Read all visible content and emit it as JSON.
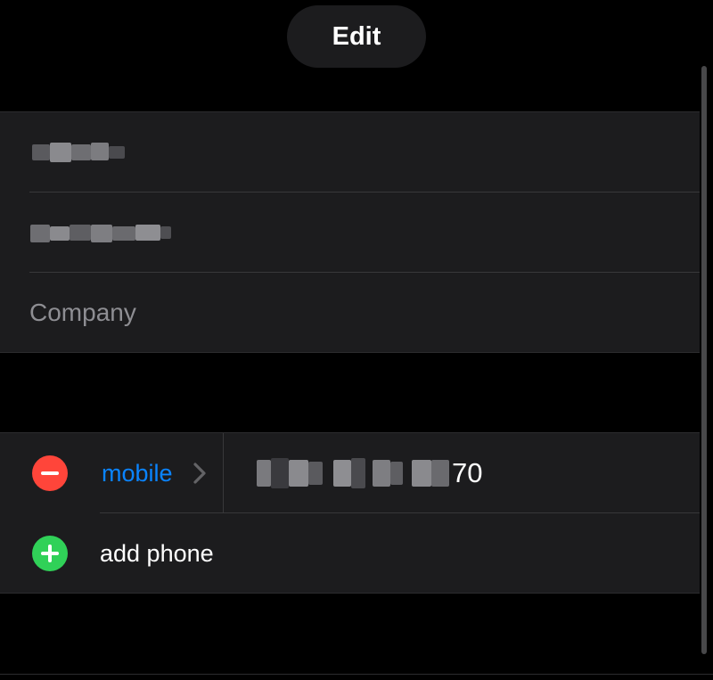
{
  "header": {
    "edit_label": "Edit"
  },
  "name_section": {
    "first_name_value": "",
    "last_name_value": "",
    "company_placeholder": "Company"
  },
  "phone_section": {
    "phone_label": "mobile",
    "phone_value_visible_suffix": "70",
    "add_phone_label": "add phone"
  },
  "icons": {
    "remove": "minus-circle-icon",
    "add": "plus-circle-icon",
    "chevron": "chevron-right-icon"
  },
  "colors": {
    "background": "#000000",
    "cell": "#1c1c1e",
    "accent": "#0a84ff",
    "remove": "#ff453a",
    "add": "#30d158",
    "placeholder": "#8e8e93"
  }
}
